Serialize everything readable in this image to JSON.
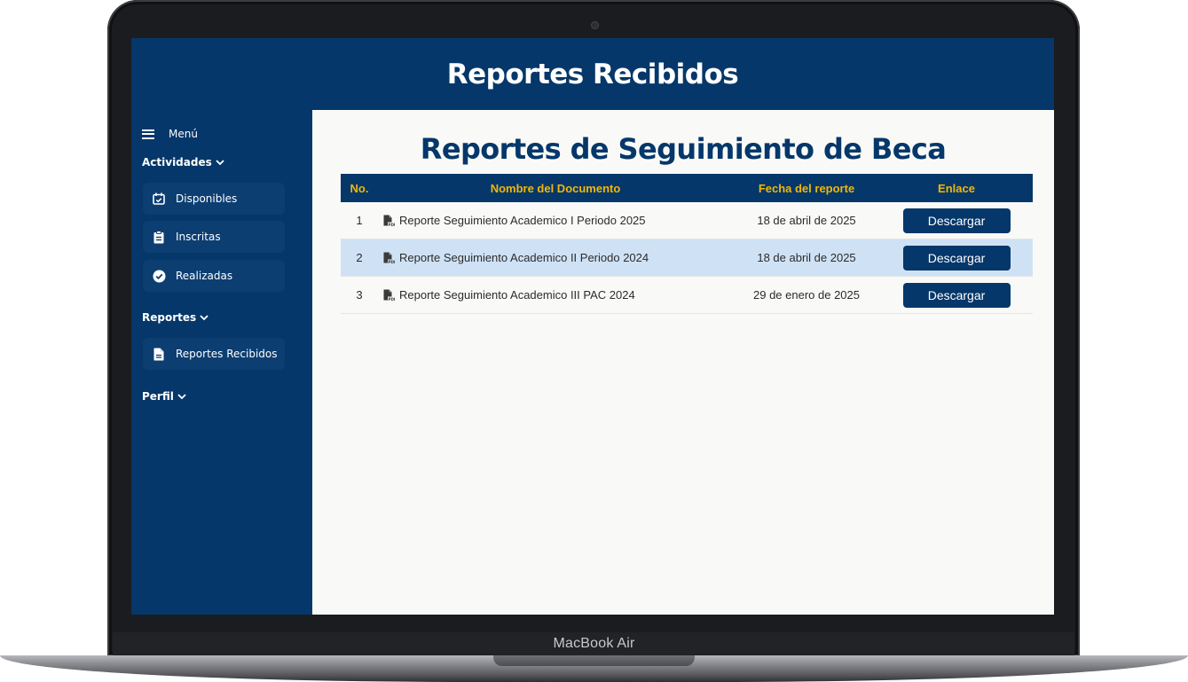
{
  "device": {
    "brand_label": "MacBook Air"
  },
  "header": {
    "title": "Reportes Recibidos"
  },
  "sidebar": {
    "menu_label": "Menú",
    "sections": {
      "actividades": {
        "title": "Actividades",
        "items": [
          {
            "label": "Disponibles",
            "icon": "calendar-check-icon"
          },
          {
            "label": "Inscritas",
            "icon": "clipboard-icon"
          },
          {
            "label": "Realizadas",
            "icon": "check-circle-icon"
          }
        ]
      },
      "reportes": {
        "title": "Reportes",
        "items": [
          {
            "label": "Reportes Recibidos",
            "icon": "file-icon"
          }
        ]
      },
      "perfil": {
        "title": "Perfil"
      }
    }
  },
  "main": {
    "title": "Reportes de Seguimiento de Beca",
    "table": {
      "headers": [
        "No.",
        "Nombre del Documento",
        "Fecha del reporte",
        "Enlace"
      ],
      "rows": [
        {
          "no": "1",
          "name": "Reporte Seguimiento Academico I Periodo 2025",
          "date": "18 de abril de 2025",
          "link_label": "Descargar"
        },
        {
          "no": "2",
          "name": "Reporte Seguimiento Academico II Periodo 2024",
          "date": "18 de abril de 2025",
          "link_label": "Descargar"
        },
        {
          "no": "3",
          "name": "Reporte Seguimiento Academico III PAC 2024",
          "date": "29 de enero de 2025",
          "link_label": "Descargar"
        }
      ]
    }
  },
  "colors": {
    "primary": "#05376a",
    "header_text": "#f2b705",
    "row_highlight": "#cfe2f5",
    "background": "#f9faf7"
  }
}
